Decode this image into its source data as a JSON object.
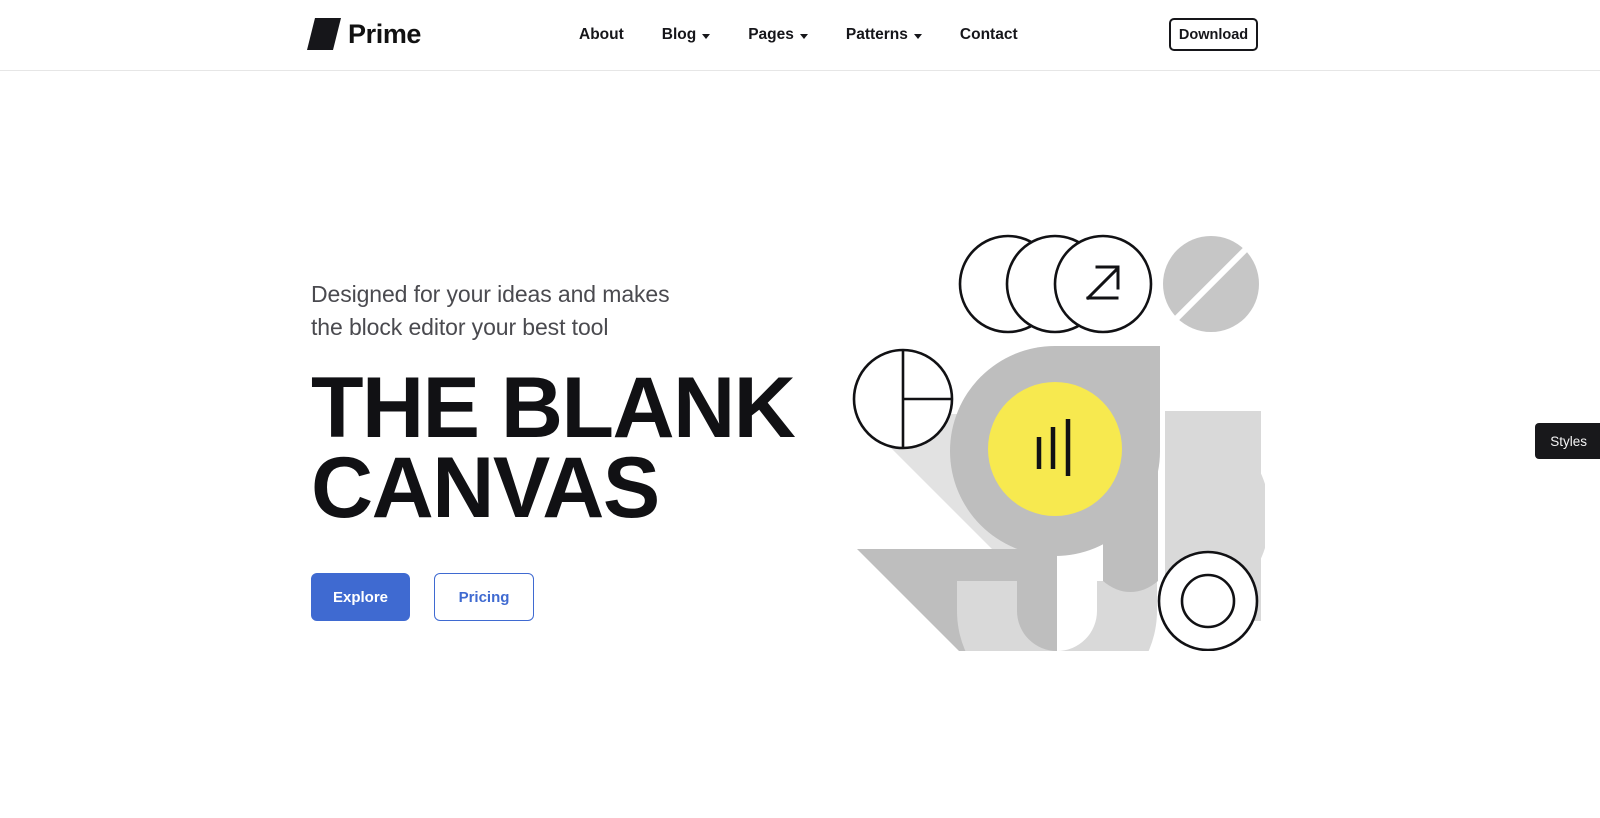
{
  "header": {
    "brand": {
      "name": "Prime",
      "mark_color": "#16161a"
    },
    "nav": [
      {
        "label": "About",
        "has_dropdown": false
      },
      {
        "label": "Blog",
        "has_dropdown": true
      },
      {
        "label": "Pages",
        "has_dropdown": true
      },
      {
        "label": "Patterns",
        "has_dropdown": true
      },
      {
        "label": "Contact",
        "has_dropdown": false
      }
    ],
    "download_label": "Download"
  },
  "hero": {
    "subtitle_line1": "Designed for your ideas and makes",
    "subtitle_line2": "the block editor your best tool",
    "title_line1": "THE BLANK",
    "title_line2": "CANVAS",
    "primary_button": "Explore",
    "secondary_button": "Pricing"
  },
  "editor": {
    "styles_tab_label": "Styles"
  },
  "colors": {
    "accent_blue": "#3f6ad1",
    "ink": "#111114",
    "yellow": "#f6e košice",
    "highlight_yellow": "#f7e94f",
    "gray_medium": "#bebebe",
    "gray_light": "#d9d9d9",
    "gray_lighter": "#e2e2e2",
    "black": "#16161a"
  },
  "illustration": {
    "shapes": [
      "overlapping-circles-outline",
      "arrow-up-right-icon",
      "diagonal-split-circle",
      "quarter-divided-circle",
      "rounded-square-blob",
      "yellow-circle-bar-chart",
      "half-circle-right",
      "triangle-light",
      "triangle-dark",
      "u-arc-shape",
      "concentric-rings"
    ]
  }
}
